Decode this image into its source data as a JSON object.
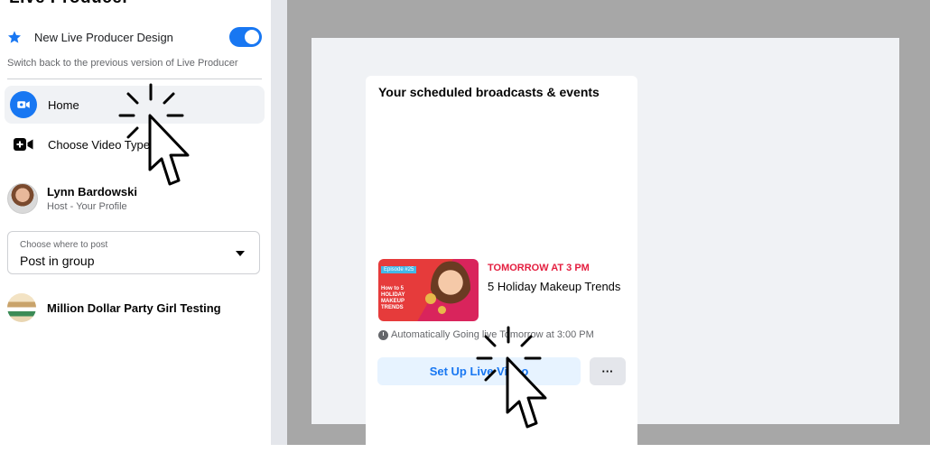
{
  "sidebar": {
    "cut_title": "Live Producer",
    "design_label": "New Live Producer Design",
    "design_toggle_on": true,
    "switch_back_text": "Switch back to the previous version of Live Producer",
    "nav": [
      {
        "label": "Home",
        "icon": "camera-icon",
        "active": true
      },
      {
        "label": "Choose Video Type",
        "icon": "video-add-icon",
        "active": false
      }
    ],
    "profile": {
      "name": "Lynn Bardowski",
      "role": "Host - Your Profile"
    },
    "post_select": {
      "caption": "Choose where to post",
      "value": "Post in group"
    },
    "group": {
      "name": "Million Dollar Party Girl Testing"
    }
  },
  "main": {
    "card_title": "Your scheduled broadcasts & events",
    "event": {
      "when": "TOMORROW AT 3 PM",
      "title": "5 Holiday Makeup Trends",
      "thumb_episode": "Episode #25",
      "thumb_text": "How to 5 HOLIDAY MAKEUP TRENDS",
      "auto_text": "Automatically Going live Tomorrow at 3:00 PM"
    },
    "setup_label": "Set Up Live Video",
    "more_label": "···"
  },
  "colors": {
    "accent": "#1877f2",
    "accent_light": "#e7f3ff",
    "alert": "#e41e3f",
    "backdrop": "#a7a7a7"
  }
}
